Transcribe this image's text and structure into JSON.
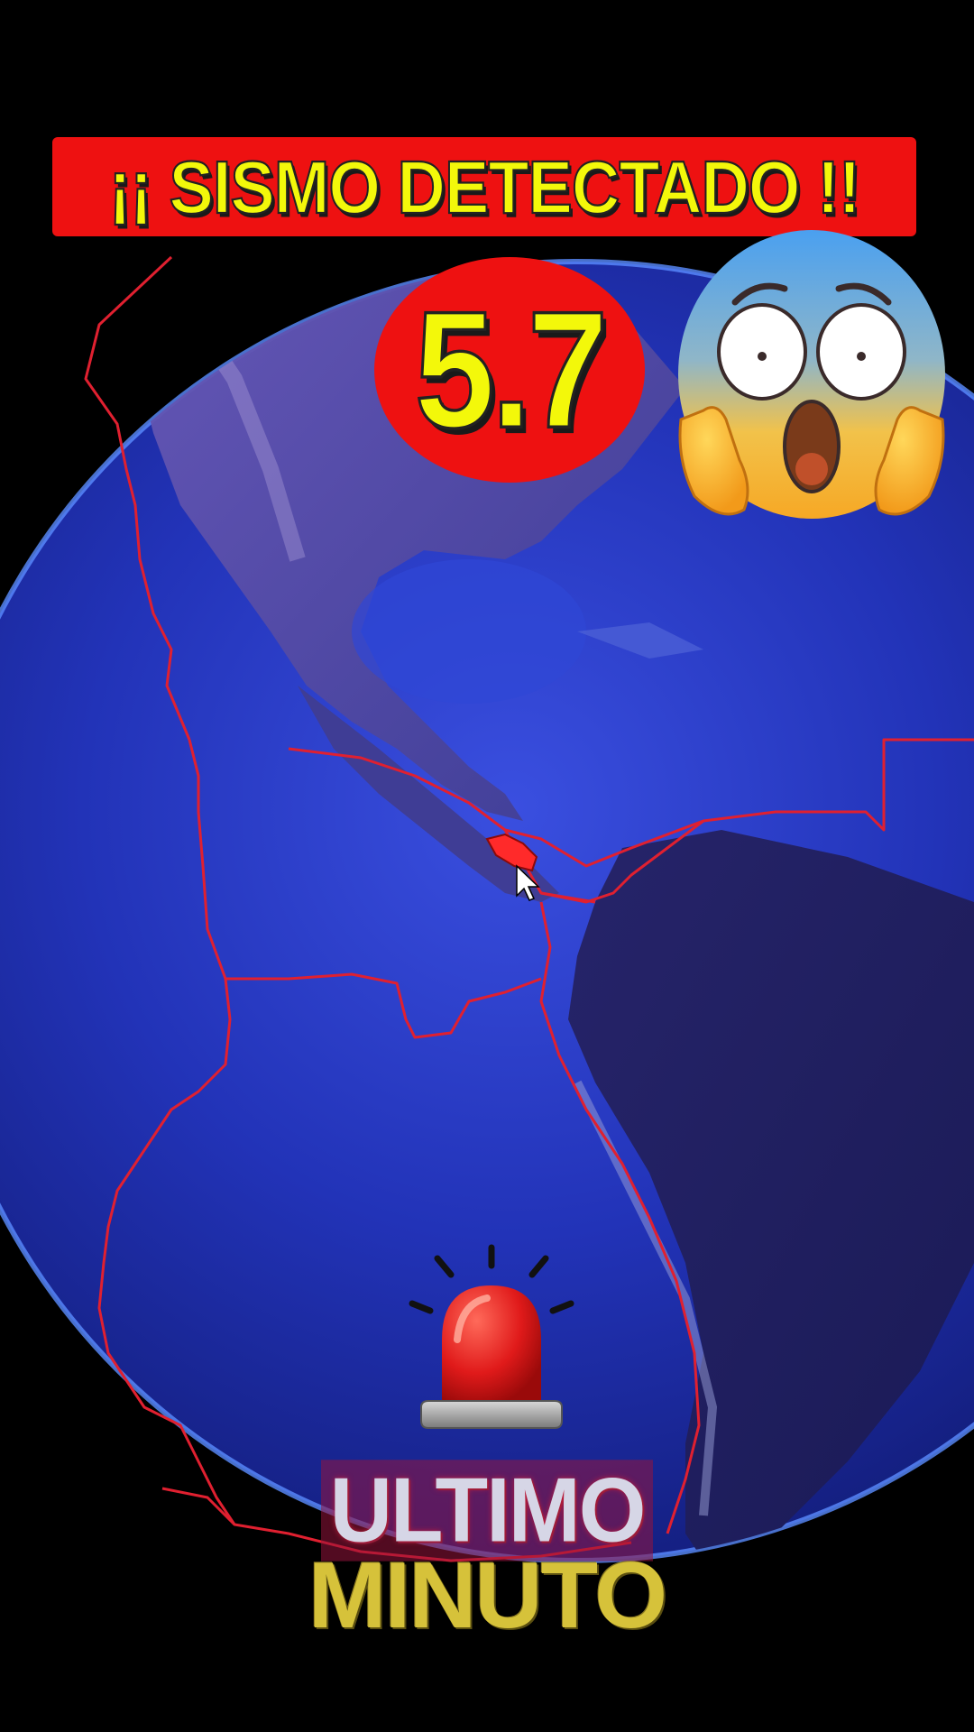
{
  "banner": {
    "title": "¡¡ SISMO DETECTADO !!"
  },
  "magnitude": {
    "value": "5.7"
  },
  "footer": {
    "line1": "ULTIMO",
    "line2": "MINUTO"
  },
  "icons": {
    "reaction": "face-screaming-in-fear-icon",
    "alert": "police-siren-light-icon",
    "pointer": "mouse-cursor-icon",
    "marker": "epicenter-marker-icon"
  },
  "colors": {
    "banner_bg": "#ee1111",
    "banner_text": "#f3f80a",
    "plate_boundaries": "#e02030",
    "ocean": "#2233b8",
    "land": "#5b4aa8"
  }
}
